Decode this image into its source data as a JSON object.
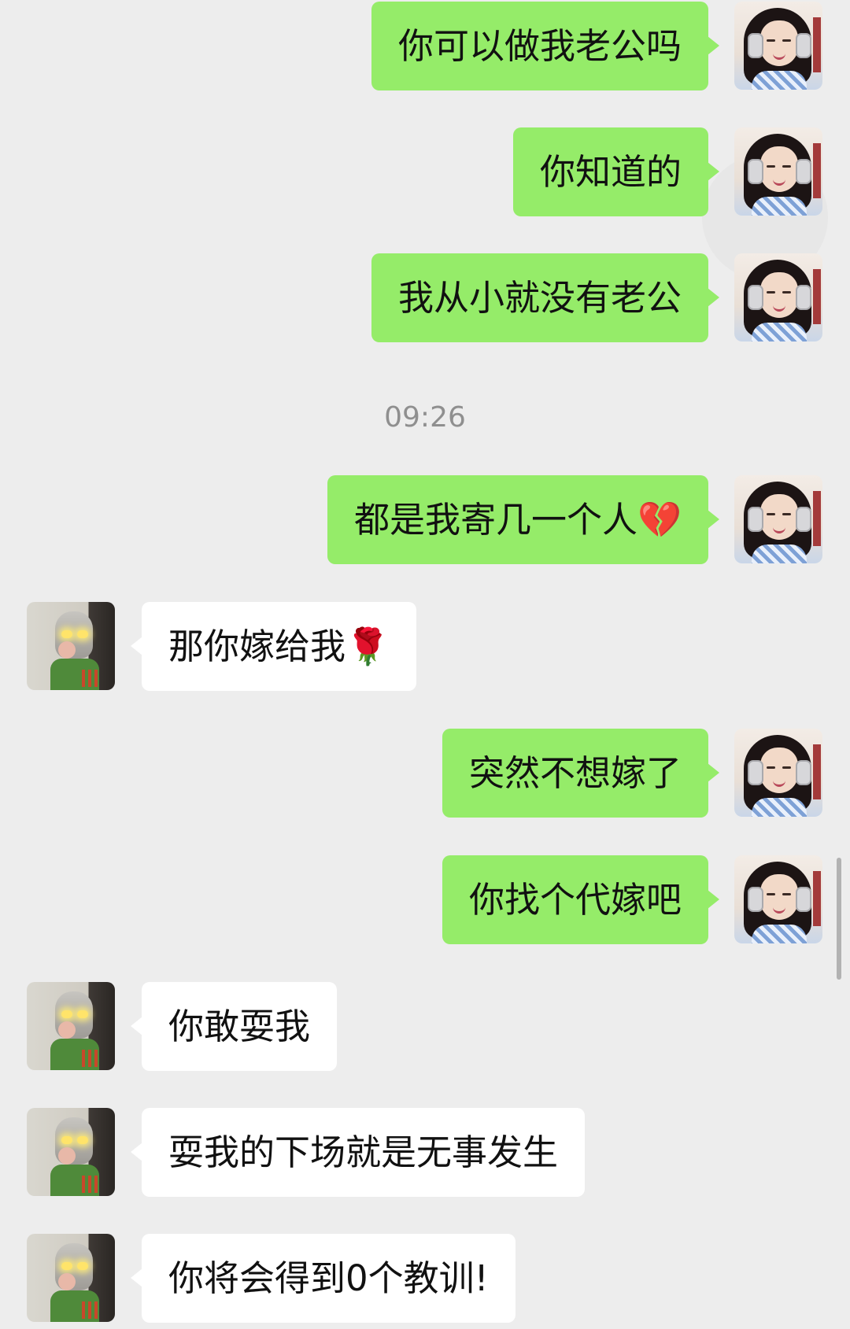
{
  "conversation": {
    "timestamp": "09:26",
    "messages": [
      {
        "side": "right",
        "text": "你可以做我老公吗"
      },
      {
        "side": "right",
        "text": "你知道的"
      },
      {
        "side": "right",
        "text": "我从小就没有老公"
      },
      {
        "side": "right",
        "text": "都是我寄几一个人💔"
      },
      {
        "side": "left",
        "text": "那你嫁给我🌹"
      },
      {
        "side": "right",
        "text": "突然不想嫁了"
      },
      {
        "side": "right",
        "text": "你找个代嫁吧"
      },
      {
        "side": "left",
        "text": "你敢耍我"
      },
      {
        "side": "left",
        "text": "耍我的下场就是无事发生"
      },
      {
        "side": "left",
        "text": "你将会得到0个教训!"
      }
    ]
  },
  "colors": {
    "background": "#ededed",
    "outgoing_bubble": "#95ec69",
    "incoming_bubble": "#ffffff",
    "timestamp_text": "#8f8f8f"
  },
  "icons": {
    "my_avatar": "girl-with-headphones-avatar",
    "other_avatar": "glowing-eyes-figure-avatar"
  }
}
